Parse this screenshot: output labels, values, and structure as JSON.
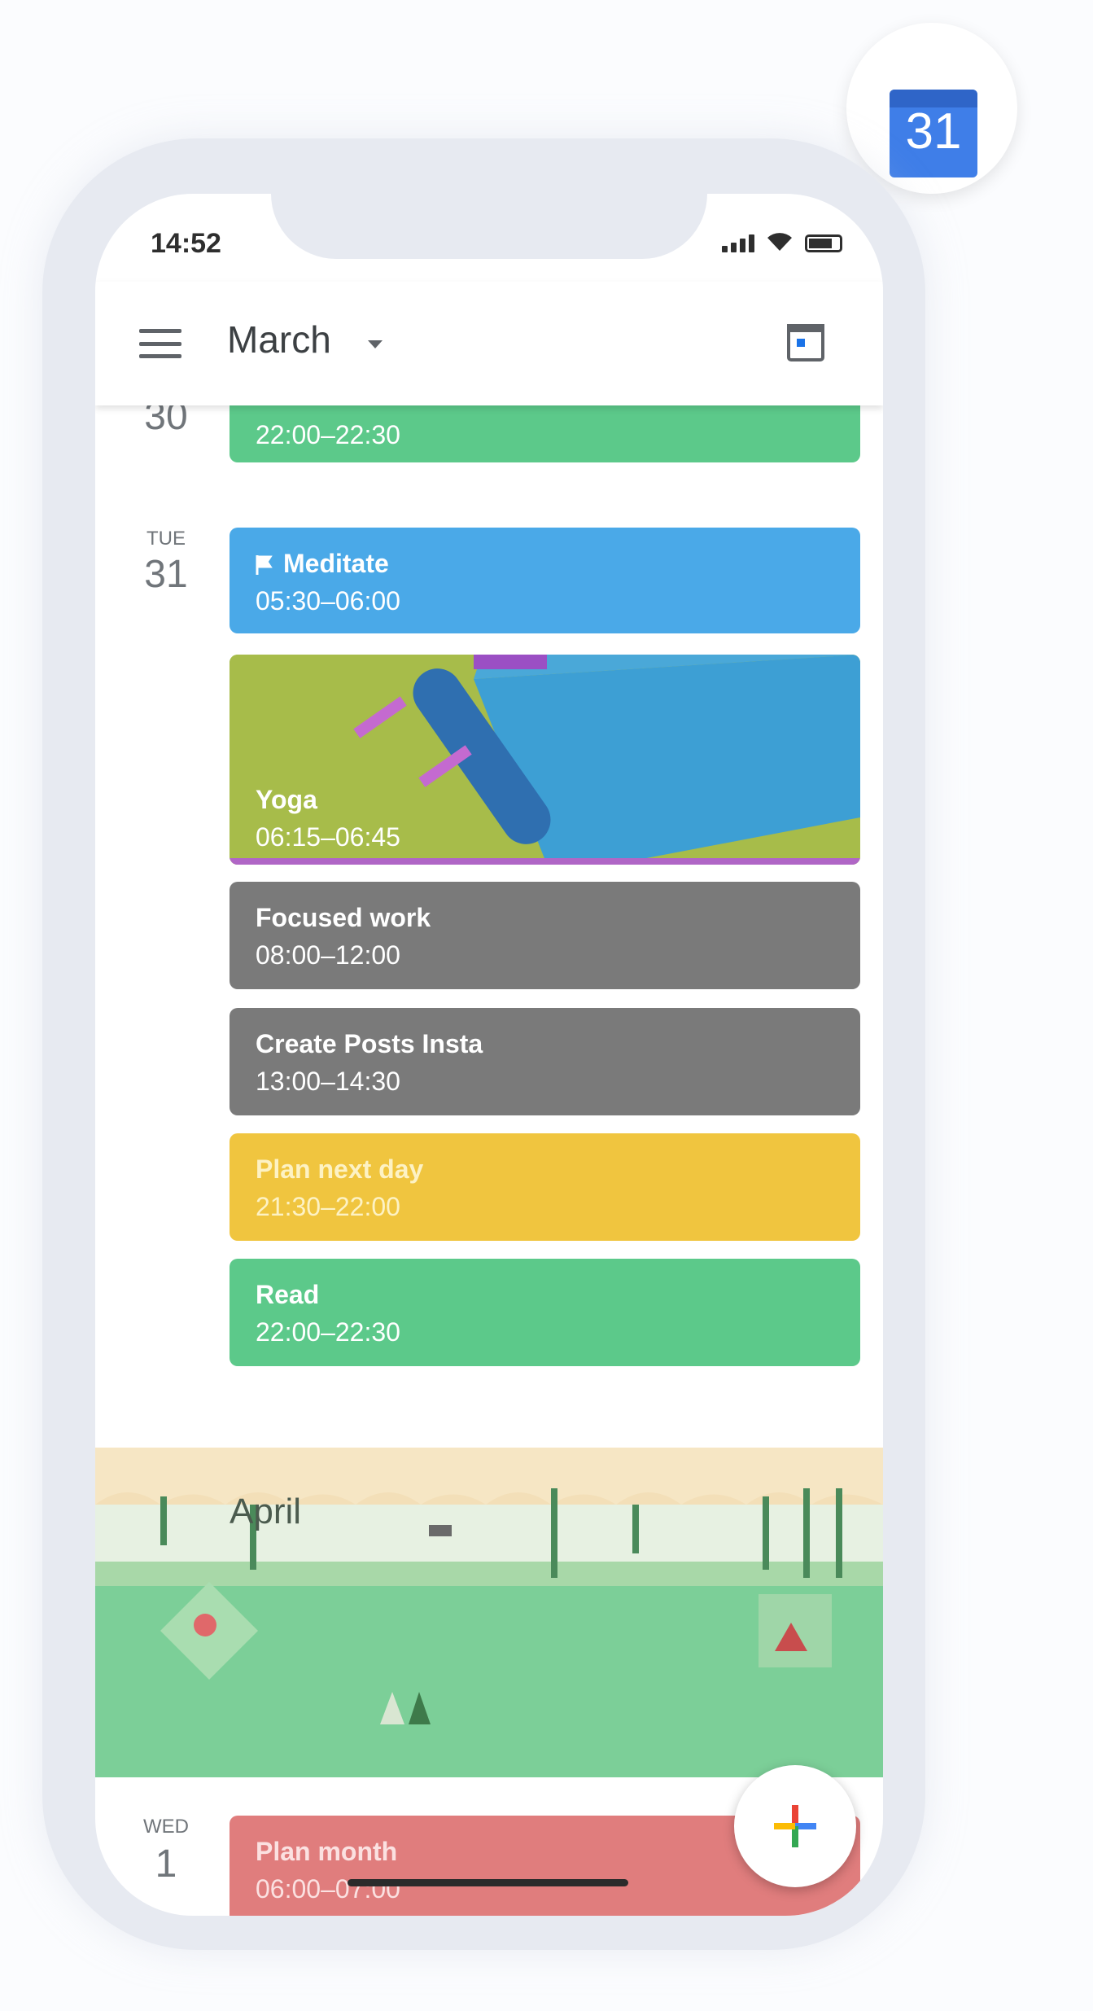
{
  "app_logo": {
    "day": "31",
    "color": "#3f7ee8"
  },
  "status_bar": {
    "time": "14:52"
  },
  "toolbar": {
    "month_label": "March"
  },
  "days": [
    {
      "day_of_week": "",
      "day_number": "30"
    },
    {
      "day_of_week": "TUE",
      "day_number": "31"
    },
    {
      "day_of_week": "WED",
      "day_number": "1"
    }
  ],
  "events": [
    {
      "title": "",
      "time": "22:00–22:30",
      "color": "#5cc98a"
    },
    {
      "title": "Meditate",
      "time": "05:30–06:00",
      "color": "#4aa9e8",
      "icon": "flag-icon"
    },
    {
      "title": "Yoga",
      "time": "06:15–06:45",
      "color": "#a7bc4a",
      "image": "yoga-mat-illustration"
    },
    {
      "title": "Focused work",
      "time": "08:00–12:00",
      "color": "#7a7a7a"
    },
    {
      "title": "Create Posts Insta",
      "time": "13:00–14:30",
      "color": "#7a7a7a"
    },
    {
      "title": "Plan next day",
      "time": "21:30–22:00",
      "color": "#f0c53f"
    },
    {
      "title": "Read",
      "time": "22:00–22:30",
      "color": "#5cc98a"
    },
    {
      "title": "Plan month",
      "time": "06:00–07:00",
      "color": "#e07d7d"
    }
  ],
  "month_banner": {
    "label": "April"
  },
  "fab": {
    "icon": "plus-icon"
  }
}
